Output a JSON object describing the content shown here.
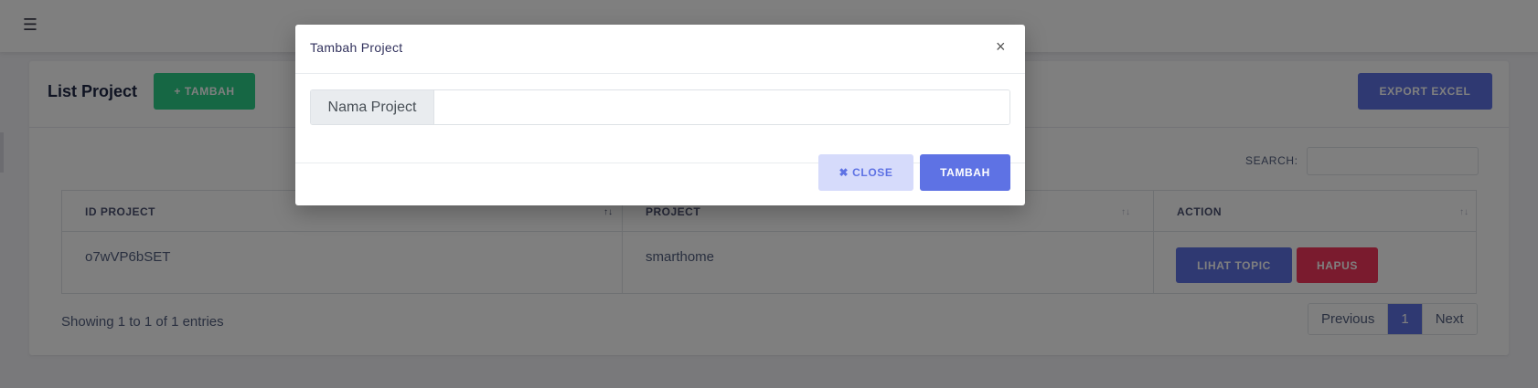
{
  "topbar": {
    "menu_icon": "hamburger-icon"
  },
  "card": {
    "title": "List Project",
    "add_button": "+ TAMBAH",
    "export_button": "EXPORT EXCEL"
  },
  "search": {
    "label": "SEARCH:",
    "value": ""
  },
  "table": {
    "columns": [
      {
        "label": "ID PROJECT"
      },
      {
        "label": "PROJECT"
      },
      {
        "label": "ACTION"
      }
    ],
    "rows": [
      {
        "id": "o7wVP6bSET",
        "project": "smarthome",
        "view_button": "LIHAT TOPIC",
        "delete_button": "HAPUS"
      }
    ]
  },
  "info": "Showing 1 to 1 of 1 entries",
  "pagination": {
    "prev": "Previous",
    "current": "1",
    "next": "Next"
  },
  "modal": {
    "title": "Tambah Project",
    "close_x": "×",
    "input_label": "Nama Project",
    "input_value": "",
    "close_button": "✖ CLOSE",
    "submit_button": "TAMBAH"
  },
  "colors": {
    "success": "#2dce89",
    "primary": "#5e72e4",
    "danger": "#f5365c",
    "primary_soft": "#d6dbfb"
  }
}
